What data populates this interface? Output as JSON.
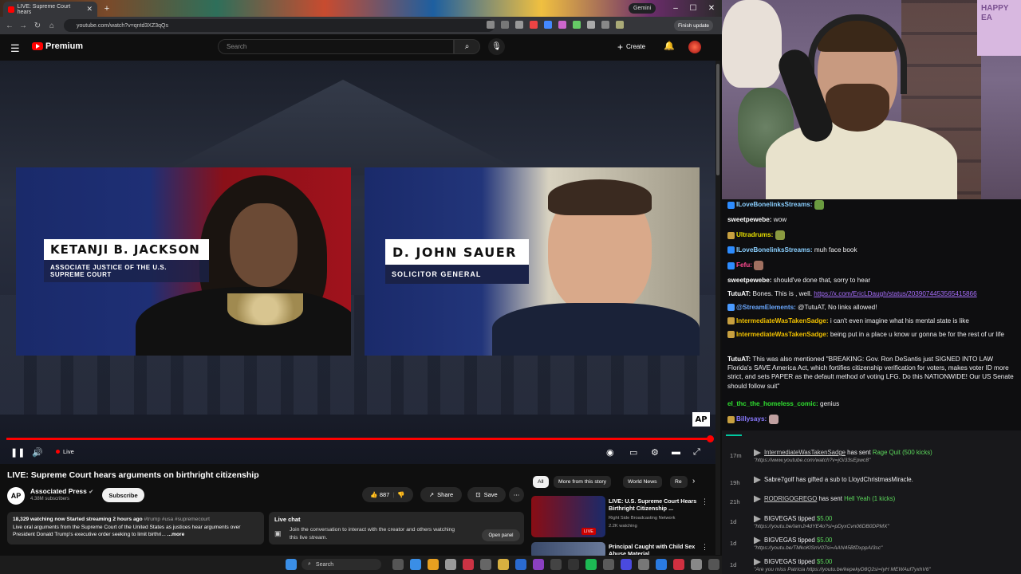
{
  "browser": {
    "tab_title": "LIVE: Supreme Court hears",
    "url": "youtube.com/watch?v=qntd3XZ3qQs",
    "gemini": "Gemini",
    "finish_update": "Finish update"
  },
  "youtube": {
    "logo": "Premium",
    "search_placeholder": "Search",
    "create_label": "Create",
    "video": {
      "title": "LIVE: Supreme Court hears arguments on birthright citizenship",
      "live_label": "Live",
      "progress": 0.99,
      "lower_third_left_name": "KETANJI B. JACKSON",
      "lower_third_left_role": "ASSOCIATE JUSTICE OF THE U.S. SUPREME COURT",
      "lower_third_right_name": "D. JOHN SAUER",
      "lower_third_right_role": "SOLICITOR GENERAL",
      "watermark": "AP"
    },
    "channel": {
      "avatar_text": "AP",
      "name": "Associated Press",
      "subscribers": "4.38M subscribers",
      "subscribe_label": "Subscribe"
    },
    "actions": {
      "likes": "887",
      "share": "Share",
      "save": "Save"
    },
    "description": {
      "stats": "18,329 watching now  Started streaming 2 hours ago",
      "tags": " #trump #usa #supremecourt",
      "text": "Live oral arguments from the Supreme Court of the United States as justices hear arguments over President Donald Trump's executive order seeking to limit birthri...",
      "more": "...more"
    },
    "live_chat": {
      "title": "Live chat",
      "text": "Join the conversation to interact with the creator and others watching this live stream.",
      "open_panel": "Open panel"
    },
    "chips": [
      "All",
      "More from this story",
      "World News",
      "Re"
    ],
    "recommendations": [
      {
        "title": "LIVE: U.S. Supreme Court Hears Birthright Citizenship ...",
        "channel": "Right Side Broadcasting Network",
        "meta": "2.2K watching",
        "badge": "LIVE"
      },
      {
        "title": "Principal Caught with Child Sex Abuse Material",
        "channel": "",
        "meta": "",
        "badge": ""
      }
    ]
  },
  "taskbar": {
    "search": "Search"
  },
  "webcam": {
    "sign_text": "HAPPY EA"
  },
  "chat": [
    {
      "name": "ILoveBonelinksStreams:",
      "color": "#8acfff",
      "text": "",
      "badge_color": "#2d8cff",
      "emote": "#6a9a40"
    },
    {
      "name": "sweetpewebe:",
      "color": "#ffffff",
      "text": "wow",
      "badge_color": "",
      "emote": ""
    },
    {
      "name": "Ultradrums:",
      "color": "#e8e000",
      "text": "",
      "badge_color": "#c8a040",
      "emote": "#8a9a40"
    },
    {
      "name": "ILoveBonelinksStreams:",
      "color": "#8acfff",
      "text": "muh face book",
      "badge_color": "#2d8cff",
      "emote": ""
    },
    {
      "name": "Fefu:",
      "color": "#ff4a90",
      "text": "",
      "badge_color": "#2d8cff",
      "emote": "#a07060"
    },
    {
      "name": "sweetpewebe:",
      "color": "#ffffff",
      "text": "should've done that, sorry to hear",
      "badge_color": "",
      "emote": ""
    },
    {
      "name": "TutuAT:",
      "color": "#ffffff",
      "text": "Bones. This is , well. ",
      "link": "https://x.com/EricLDaugh/status/2039074453565415866",
      "badge_color": "",
      "emote": ""
    },
    {
      "name": "@StreamElements:",
      "color": "#6aa8ff",
      "text": "@TutuAT, No links allowed!",
      "badge_color": "#4a9aff",
      "emote": ""
    },
    {
      "name": "IntermediateWasTakenSadge:",
      "color": "#f0c000",
      "text": "i can't even imagine what his mental state is like",
      "badge_color": "#c8a040",
      "emote": ""
    },
    {
      "name": "IntermediateWasTakenSadge:",
      "color": "#f0c000",
      "text": "being put in a place u know ur gonna be for the rest of ur life",
      "badge_color": "#c8a040",
      "emote": ""
    },
    {
      "name": "TutuAT:",
      "color": "#ffffff",
      "text": "This was also mentioned \"BREAKING: Gov. Ron DeSantis just SIGNED INTO LAW Florida's SAVE America Act, which fortifies citizenship verification for voters, makes voter ID more strict, and sets PAPER as the default method of voting LFG. Do this NATIONWIDE! Our US Senate should follow suit\"",
      "badge_color": "",
      "emote": ""
    },
    {
      "name": "el_thc_the_homeless_comic:",
      "color": "#30e030",
      "text": "genius",
      "badge_color": "",
      "emote": ""
    },
    {
      "name": "Billysays:",
      "color": "#8a7aff",
      "text": "",
      "badge_color": "#c8a040",
      "emote": "#c0a0a0"
    }
  ],
  "events": [
    {
      "time": "17m",
      "user": "IntermediateWasTakenSadge",
      "action": " has sent ",
      "highlight": "Rage Quit (500 kicks)",
      "sub": "\"https://www.youtube.com/watch?v=jGi33sEpwc8\""
    },
    {
      "time": "19h",
      "user": "",
      "action": "Sabre7golf has gifted a sub to LloydChristmasMiracle.",
      "highlight": "",
      "sub": ""
    },
    {
      "time": "21h",
      "user": "RODRIGOGREGO",
      "action": " has sent ",
      "highlight": "Hell Yeah (1 kicks)",
      "sub": ""
    },
    {
      "time": "1d",
      "user": "",
      "action": "BIGVEGAS tipped ",
      "highlight": "$5.00",
      "sub": "\"https://youtu.be/IamJr4dYE4o?si=pDyxCvn06DB0DPMX\""
    },
    {
      "time": "1d",
      "user": "",
      "action": "BIGVEGAS tipped ",
      "highlight": "$5.00",
      "sub": "\"https://youtu.be/TMkoKlSnV07si=AAN45BfDxppAI3sc\""
    },
    {
      "time": "1d",
      "user": "",
      "action": "BIGVEGAS tipped ",
      "highlight": "$5.00",
      "sub": "\"Are you miss Patricia https://youtu.be/kepekyD8Q2si=IyH MEWAuf7yxhV6\""
    }
  ]
}
